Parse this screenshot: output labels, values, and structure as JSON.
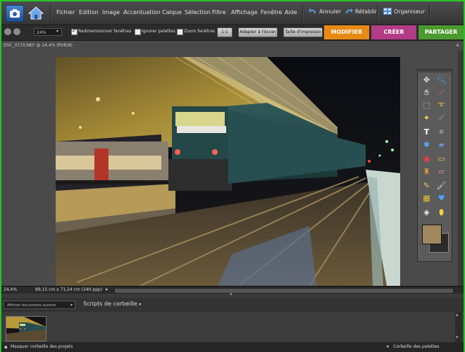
{
  "menubar": {
    "items": [
      "Fichier",
      "Edition",
      "Image",
      "Accentuation",
      "Calque",
      "Sélection",
      "Filtre",
      "Affichage",
      "Fenêtre",
      "Aide"
    ],
    "undo_label": "Annuler",
    "redo_label": "Rétablir",
    "organiser_label": "Organiseur"
  },
  "options": {
    "zoom_value": "24%",
    "resize_windows_label": "Redimensionner fenêtres",
    "ignore_palettes_label": "Ignorer palettes",
    "zoom_windows_label": "Zoom fenêtres",
    "one_to_one_label": "1:1",
    "fit_screen_label": "Adapter à l'écran",
    "print_size_label": "Taille d'impressio",
    "tabs": {
      "edit": "MODIFIER",
      "create": "CRÉER",
      "share": "PARTAGER"
    },
    "tab_colors": {
      "edit": "#e88a12",
      "create": "#b23c86",
      "share": "#4a9a2e"
    }
  },
  "document": {
    "title": "DSC_0170.NEF @ 24,4% (RVB/8)"
  },
  "status": {
    "zoom": "24,4%",
    "dimensions": "89,15 cm x 71,24 cm (240 ppp)"
  },
  "bin": {
    "dropdown_value": "Afficher documents ouverts",
    "scripts_label": "Scripts de corbeille"
  },
  "bottombar": {
    "hide_bin_label": "Masquer corbeille des projets",
    "palette_bin_label": "Corbeille des palettes"
  },
  "toolbox": {
    "tools": [
      "move-tool",
      "zoom-tool",
      "hand-tool",
      "eyedropper-tool",
      "marquee-tool",
      "lasso-tool",
      "magic-wand-tool",
      "selection-brush-tool",
      "type-tool",
      "crop-tool",
      "cookie-cutter-tool",
      "straighten-tool",
      "red-eye-tool",
      "spot-healing-tool",
      "clone-stamp-tool",
      "eraser-tool",
      "pencil-tool",
      "brush-tool",
      "paint-bucket-tool",
      "gradient-tool",
      "custom-shape-tool",
      "blur-tool",
      "sponge-tool",
      "smart-brush-tool"
    ],
    "foreground_color": "#a38a5e",
    "background_color": "#2b2b2b"
  }
}
